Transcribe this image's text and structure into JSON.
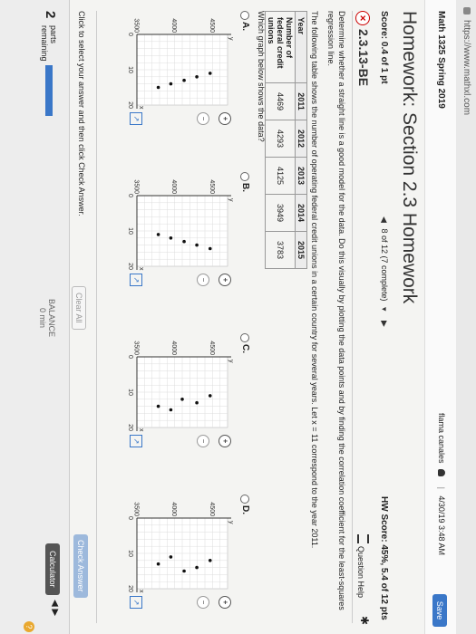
{
  "browser": {
    "url": "https://www.mathxl.com"
  },
  "header": {
    "course": "Math 1325 Spring 2019",
    "user": "flama canales",
    "separator": "|",
    "datetime": "4/30/19 3:48 AM",
    "save_label": "Save"
  },
  "assignment": {
    "title": "Homework: Section 2.3 Homework",
    "score": "Score: 0.4 of 1 pt",
    "nav_status": "8 of 12 (7 complete)",
    "hw_score": "HW Score: 45%, 5.4 of 12 pts"
  },
  "question": {
    "id": "2.3.13-BE",
    "help_label": "Question Help",
    "instruction": "Determine whether a straight line is a good model for the data. Do this visually by plotting the data points and by finding the correlation coefficient for the least-squares regression line.",
    "description": "The following table shows the number of operating federal credit unions in a certain country for several years. Let x = 11 correspond to the year 2011.",
    "table": {
      "row1_header": "Year",
      "row2_header": "Number of federal credit unions",
      "years": [
        "2011",
        "2012",
        "2013",
        "2014",
        "2015"
      ],
      "counts": [
        "4469",
        "4293",
        "4125",
        "3949",
        "3783"
      ]
    },
    "prompt": "Which graph below shows the data?",
    "options": [
      {
        "label": "A.",
        "points": [
          [
            11,
            4469
          ],
          [
            12,
            4293
          ],
          [
            13,
            4125
          ],
          [
            14,
            3949
          ],
          [
            15,
            3783
          ]
        ]
      },
      {
        "label": "B.",
        "points": [
          [
            11,
            3783
          ],
          [
            12,
            3949
          ],
          [
            13,
            4125
          ],
          [
            14,
            4293
          ],
          [
            15,
            4469
          ]
        ]
      },
      {
        "label": "C.",
        "points": [
          [
            11,
            4469
          ],
          [
            12,
            4100
          ],
          [
            13,
            4293
          ],
          [
            14,
            3783
          ],
          [
            15,
            3949
          ]
        ]
      },
      {
        "label": "D.",
        "points": [
          [
            11,
            3949
          ],
          [
            12,
            4469
          ],
          [
            13,
            3783
          ],
          [
            14,
            4293
          ],
          [
            15,
            4125
          ]
        ]
      }
    ],
    "graph": {
      "y_ticks": [
        "4500",
        "4000",
        "3500"
      ],
      "x_ticks": [
        "0",
        "10",
        "20"
      ],
      "y_axis_label": "y",
      "x_axis_label": "x",
      "xlim": [
        0,
        20
      ],
      "ylim": [
        3500,
        4700
      ]
    },
    "zoom_in": "+",
    "zoom_out": "−",
    "expand": "↗"
  },
  "actions": {
    "message": "Click to select your answer and then click Check Answer.",
    "clear_all": "Clear All",
    "check_answer": "Check Answer"
  },
  "footer": {
    "parts_count": "2",
    "parts_word": "parts",
    "parts_remaining": "remaining",
    "balance": "BALANCE",
    "balance_value": "0 min",
    "calculator": "Calculator",
    "help": "?"
  }
}
